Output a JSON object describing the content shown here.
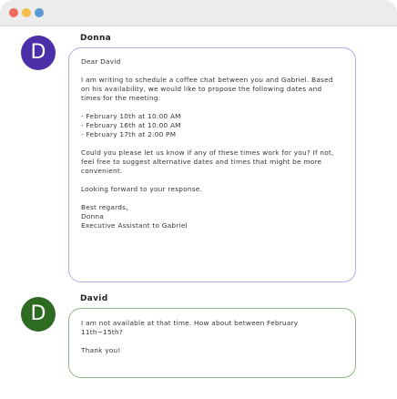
{
  "window": {
    "controls": [
      "close",
      "minimize",
      "zoom"
    ]
  },
  "messages": [
    {
      "sender": "Donna",
      "avatar_letter": "D",
      "avatar_color": "#4b2fa8",
      "bubble_border": "#b8a8e6",
      "paragraphs": [
        "Dear David",
        "I am writing to schedule a coffee chat between you and Gabriel. Based on his availability, we would like to propose the following dates and times for the meeting:",
        "- February 10th at 10:00 AM\n- February 16th at 10:00 AM\n- February 17th at 2:00 PM",
        "Could you please let us know if any of these times work for you? If not, feel free to suggest alternative dates and times that might be more convenient.",
        "Looking forward to your response.",
        "Best regards,\nDonna\nExecutive Assistant to Gabriel"
      ]
    },
    {
      "sender": "David",
      "avatar_letter": "D",
      "avatar_color": "#2e6b22",
      "bubble_border": "#8fb58a",
      "paragraphs": [
        "I am not available at that time. How about between February  11th~15th?",
        "Thank you!"
      ]
    }
  ]
}
